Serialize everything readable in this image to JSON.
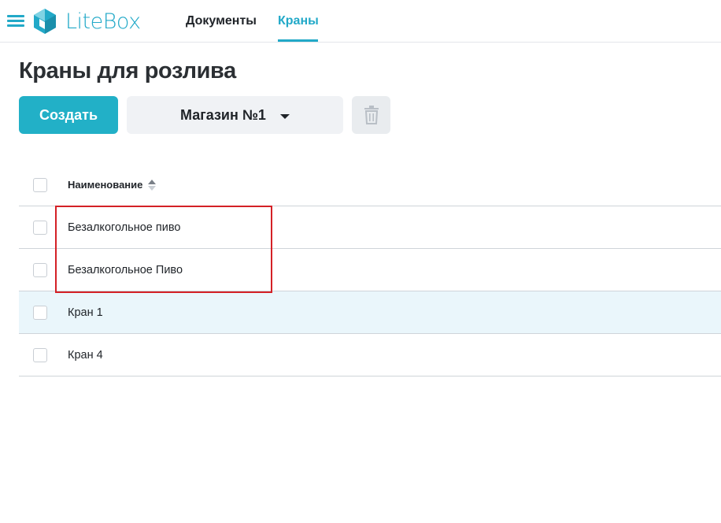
{
  "app": {
    "logo_text": "LiteBox",
    "brand_color": "#22a9c8"
  },
  "nav": {
    "tabs": [
      {
        "label": "Документы",
        "active": false
      },
      {
        "label": "Краны",
        "active": true
      }
    ]
  },
  "page": {
    "title": "Краны для розлива"
  },
  "toolbar": {
    "create_label": "Создать",
    "store_select_value": "Магазин №1",
    "delete_icon": "trash-icon"
  },
  "table": {
    "column_name": "Наименование",
    "rows": [
      {
        "name": "Безалкогольное пиво"
      },
      {
        "name": "Безалкогольное Пиво"
      },
      {
        "name": "Кран 1"
      },
      {
        "name": "Кран 4"
      }
    ]
  }
}
